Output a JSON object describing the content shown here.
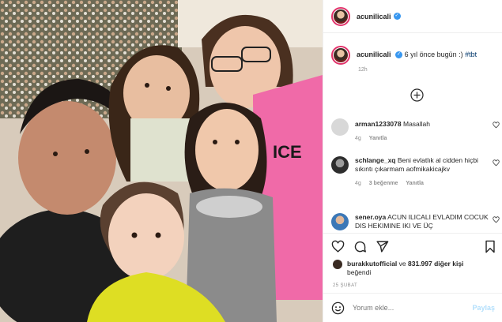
{
  "post": {
    "username": "acunilicali",
    "caption_text": "6 yıl önce bugün :) ",
    "caption_hashtag": "#tbt",
    "time": "12h",
    "date": "25 ŞUBAT"
  },
  "comments": [
    {
      "username": "arman1233078",
      "text": "Masallah",
      "age": "4g",
      "likes": "",
      "reply": "Yanıtla"
    },
    {
      "username": "schlange_xq",
      "text": "Beni evlatlık al cidden hiçbi sıkıntı çıkarmam aofmikakicajkv",
      "age": "4g",
      "likes": "3 beğenme",
      "reply": "Yanıtla"
    },
    {
      "username": "sener.oya",
      "text": "ACUN ILICALI EVLADIM COCUK DIS HEKIMINE IKI VE ÜÇ",
      "age": "",
      "likes": "",
      "reply": ""
    }
  ],
  "likes": {
    "user": "burakkutofficial",
    "connector": " ve ",
    "count": "831.997 diğer kişi",
    "suffix": "beğendi"
  },
  "add_comment": {
    "placeholder": "Yorum ekle...",
    "share_label": "Paylaş"
  },
  "icons": {
    "verified": "verified-badge-icon",
    "more": "load-more-comments-icon",
    "heart": "heart-icon",
    "comment": "comment-icon",
    "share": "share-icon",
    "save": "bookmark-icon",
    "emoji": "emoji-icon"
  },
  "colors": {
    "accent": "#3897f0",
    "link": "#00376b",
    "muted": "#8e8e8e",
    "story_ring": "#e2336b"
  }
}
